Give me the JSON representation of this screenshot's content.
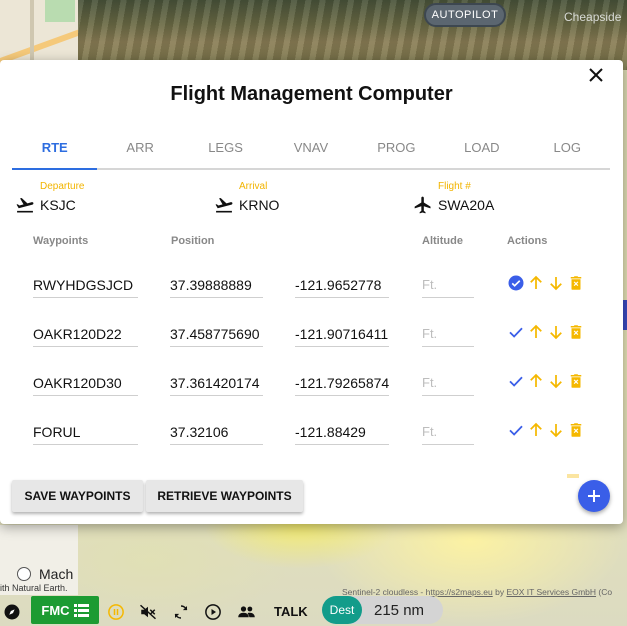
{
  "map": {
    "autopilot_label": "AUTOPILOT",
    "place_label": "Cheapside",
    "mach_label": "Mach",
    "credit_left": "ith Natural Earth.",
    "credit_sentinel": "Sentinel-2 cloudless - ",
    "credit_url": "https://s2maps.eu",
    "credit_by": " by ",
    "credit_eox": "EOX IT Services GmbH",
    "credit_tail": " (Co"
  },
  "fmc": {
    "title": "Flight Management Computer",
    "tabs": [
      "RTE",
      "ARR",
      "LEGS",
      "VNAV",
      "PROG",
      "LOAD",
      "LOG"
    ],
    "active_tab": "RTE",
    "departure": {
      "label": "Departure",
      "value": "KSJC"
    },
    "arrival": {
      "label": "Arrival",
      "value": "KRNO"
    },
    "flight": {
      "label": "Flight #",
      "value": "SWA20A"
    },
    "columns": {
      "waypoints": "Waypoints",
      "position": "Position",
      "altitude": "Altitude",
      "actions": "Actions"
    },
    "altitude_placeholder": "Ft.",
    "waypoints": [
      {
        "name": "RWYHDGSJCD",
        "lat": "37.39888889",
        "lon": "-121.9652778",
        "alt": "",
        "selected": true
      },
      {
        "name": "OAKR120D22",
        "lat": "37.458775690",
        "lon": "-121.90716411",
        "alt": "",
        "selected": false
      },
      {
        "name": "OAKR120D30",
        "lat": "37.361420174",
        "lon": "-121.79265874",
        "alt": "",
        "selected": false
      },
      {
        "name": "FORUL",
        "lat": "37.32106",
        "lon": "-121.88429",
        "alt": "",
        "selected": false
      }
    ],
    "save_label": "SAVE WAYPOINTS",
    "retrieve_label": "RETRIEVE WAYPOINTS",
    "add_icon": "plus-icon"
  },
  "toolbar": {
    "fmc_label": "FMC",
    "talk_label": "TALK",
    "dest_label": "Dest",
    "dest_value": "215 nm"
  },
  "colors": {
    "accent": "#2d6de0",
    "label_yellow": "#f2b400",
    "fmc_green": "#1c9b32",
    "dest_teal": "#129c8a",
    "fab_blue": "#3a5ee8"
  }
}
